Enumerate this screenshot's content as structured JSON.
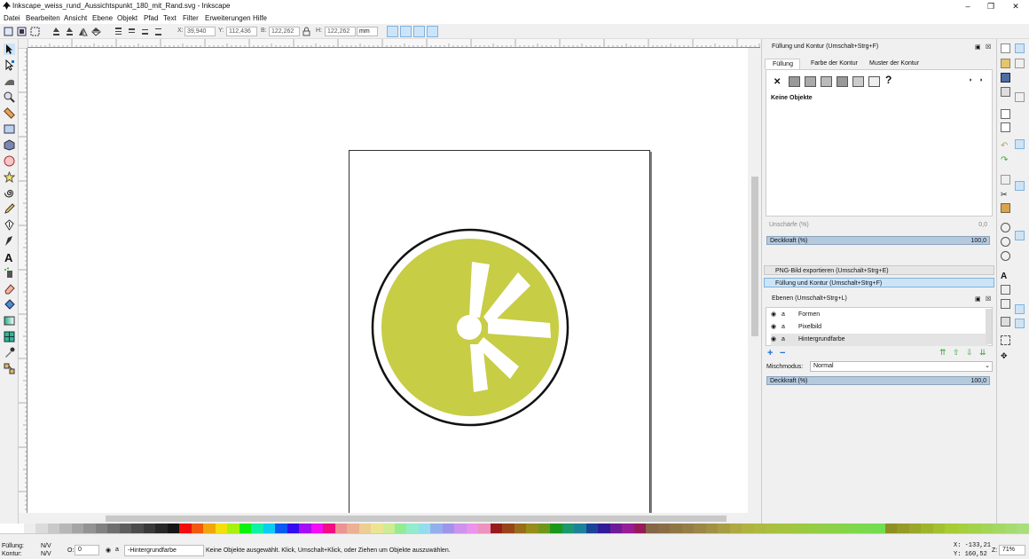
{
  "window": {
    "title": "Inkscape_weiss_rund_Aussichtspunkt_180_mit_Rand.svg - Inkscape",
    "minimize": "‒",
    "restore": "❐",
    "close": "✕"
  },
  "menu": [
    "Datei",
    "Bearbeiten",
    "Ansicht",
    "Ebene",
    "Objekt",
    "Pfad",
    "Text",
    "Filter",
    "Erweiterungen",
    "Hilfe"
  ],
  "toolbar": {
    "x_label": "X:",
    "x_value": "39,940",
    "y_label": "Y:",
    "y_value": "112,436",
    "b_label": "B:",
    "b_value": "122,262",
    "h_label": "H:",
    "h_value": "122,262",
    "unit": "mm"
  },
  "fill_stroke": {
    "header": "Füllung und Kontur (Umschalt+Strg+F)",
    "tab_fill": "Füllung",
    "tab_stroke_paint": "Farbe der Kontur",
    "tab_stroke_style": "Muster der Kontur",
    "no_objects": "Keine Objekte",
    "question": "?",
    "blur_label": "Unschärfe (%)",
    "blur_value": "0,0",
    "opacity_label": "Deckkraft (%)",
    "opacity_value": "100,0"
  },
  "collapsed_panels": [
    "PNG-Bild exportieren (Umschalt+Strg+E)",
    "Füllung und Kontur (Umschalt+Strg+F)"
  ],
  "layers": {
    "header": "Ebenen (Umschalt+Strg+L)",
    "items": [
      "Formen",
      "Pixelbild",
      "Hintergrundfarbe"
    ],
    "blend_label": "Mischmodus:",
    "blend_value": "Normal",
    "opacity_label": "Deckkraft (%)",
    "opacity_value": "100,0"
  },
  "status": {
    "fill_label": "Füllung:",
    "fill_value": "N/V",
    "stroke_label": "Kontur:",
    "stroke_value": "N/V",
    "o_label": "O:",
    "o_value": "0",
    "layer_value": "-Hintergrundfarbe",
    "message": "Keine Objekte ausgewählt. Klick, Umschalt+Klick, oder Ziehen um Objekte auszuwählen.",
    "x_coord": "X: -133,21",
    "y_coord": "Y:  160,52",
    "zoom_label": "Z:",
    "zoom_value": "71%"
  },
  "colors": {
    "accent": "#c7cd45",
    "selection": "#cde4f7"
  }
}
